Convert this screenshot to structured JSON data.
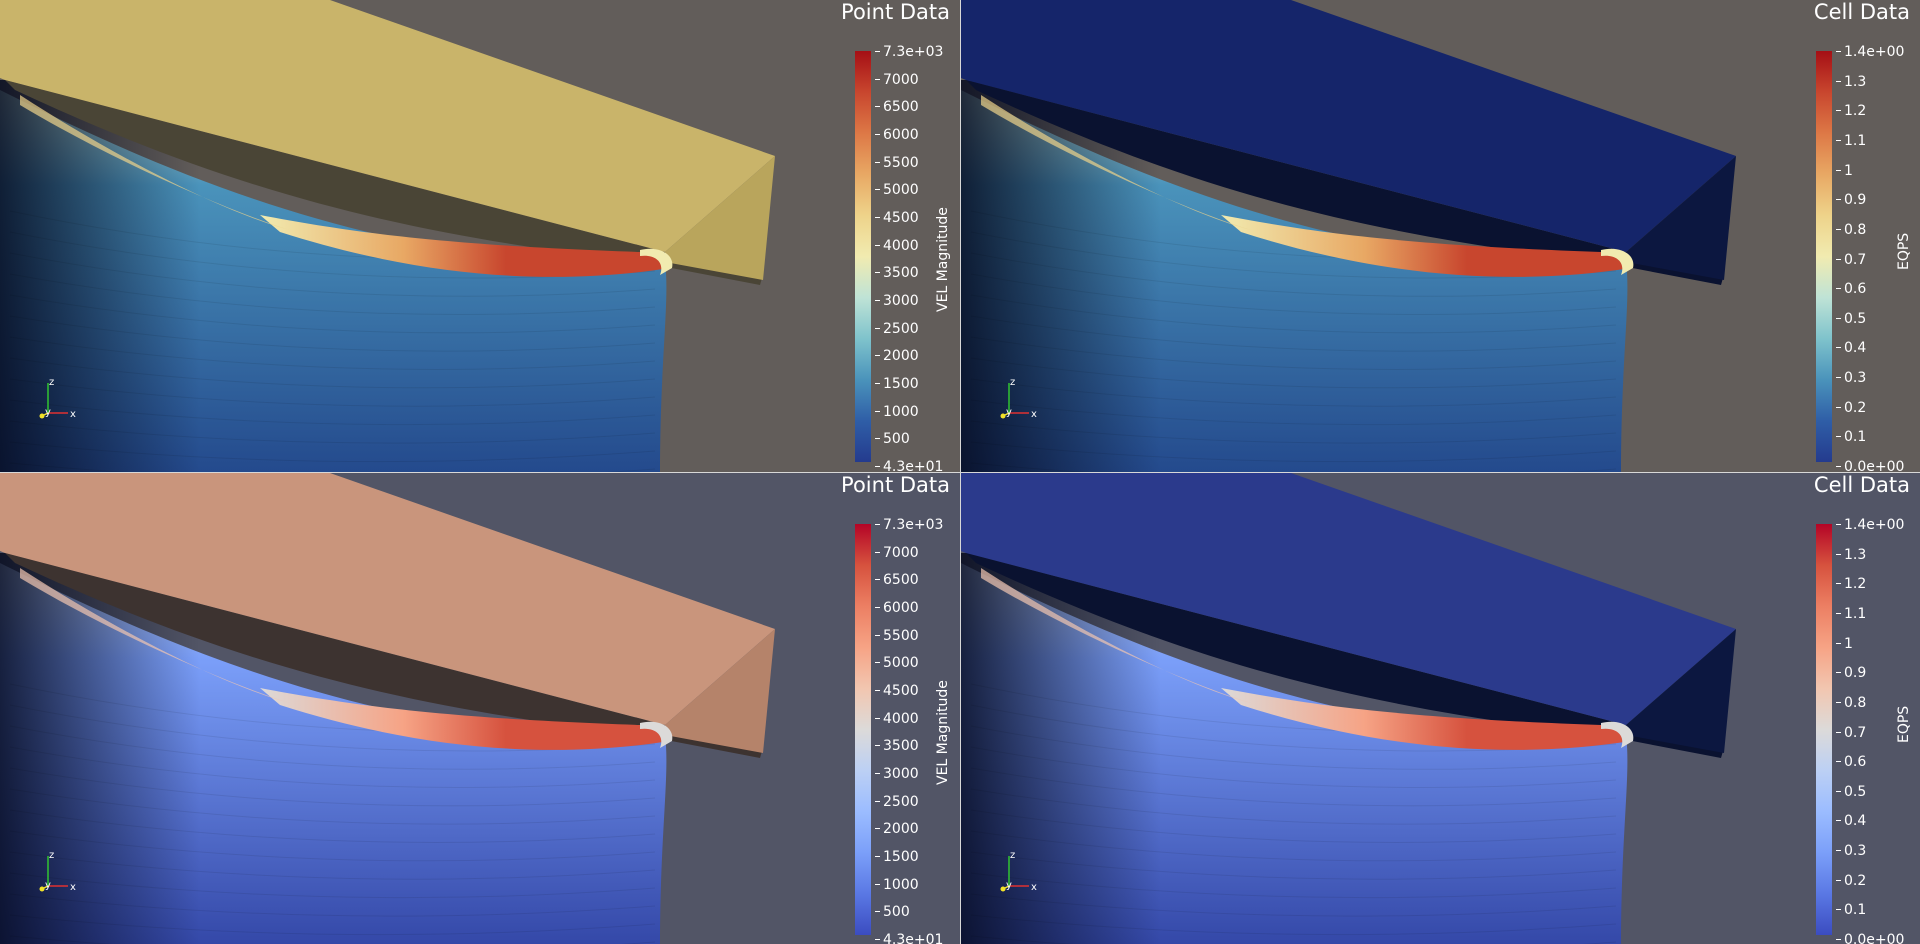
{
  "views": [
    {
      "title": "Point Data",
      "colorbar_title": "VEL Magnitude",
      "ticks": [
        "7.3e+03",
        "7000",
        "6500",
        "6000",
        "5500",
        "5000",
        "4500",
        "4000",
        "3500",
        "3000",
        "2500",
        "2000",
        "1500",
        "1000",
        "500",
        "4.3e+01"
      ],
      "background": "#625d5a",
      "colormap": [
        "#a50f15",
        "#c8462e",
        "#dd7846",
        "#e8a864",
        "#eed38a",
        "#f1ebb0",
        "#bfe3d6",
        "#7fc3cc",
        "#4a93bb",
        "#2f5ea7",
        "#243b8e"
      ]
    },
    {
      "title": "Cell Data",
      "colorbar_title": "EQPS",
      "ticks": [
        "1.4e+00",
        "1.3",
        "1.2",
        "1.1",
        "1",
        "0.9",
        "0.8",
        "0.7",
        "0.6",
        "0.5",
        "0.4",
        "0.3",
        "0.2",
        "0.1",
        "0.0e+00"
      ],
      "background": "#625d5a",
      "colormap": [
        "#a50f15",
        "#c8462e",
        "#dd7846",
        "#e8a864",
        "#eed38a",
        "#f1ebb0",
        "#bfe3d6",
        "#7fc3cc",
        "#4a93bb",
        "#2f5ea7",
        "#243b8e"
      ]
    },
    {
      "title": "Point Data",
      "colorbar_title": "VEL Magnitude",
      "ticks": [
        "7.3e+03",
        "7000",
        "6500",
        "6000",
        "5500",
        "5000",
        "4500",
        "4000",
        "3500",
        "3000",
        "2500",
        "2000",
        "1500",
        "1000",
        "500",
        "4.3e+01"
      ],
      "background": "#525566",
      "colormap": [
        "#b40426",
        "#d6523e",
        "#ec7f63",
        "#f6a385",
        "#f2c6b0",
        "#dcdad9",
        "#bcd0f4",
        "#9bbcff",
        "#7b9ff9",
        "#5a78e4",
        "#3b4cc0"
      ]
    },
    {
      "title": "Cell Data",
      "colorbar_title": "EQPS",
      "ticks": [
        "1.4e+00",
        "1.3",
        "1.2",
        "1.1",
        "1",
        "0.9",
        "0.8",
        "0.7",
        "0.6",
        "0.5",
        "0.4",
        "0.3",
        "0.2",
        "0.1",
        "0.0e+00"
      ],
      "background": "#525566",
      "colormap": [
        "#b40426",
        "#d6523e",
        "#ec7f63",
        "#f6a385",
        "#f2c6b0",
        "#dcdad9",
        "#bcd0f4",
        "#9bbcff",
        "#7b9ff9",
        "#5a78e4",
        "#3b4cc0"
      ]
    }
  ],
  "axes_labels": {
    "z": "z",
    "x": "x",
    "y": "y"
  },
  "colors": {
    "slab_yellow": "#c9b46a",
    "slab_peach": "#c9957c",
    "slab_blue_dark": "#15256a",
    "slab_blue": "#2b3a8c",
    "body_blue": "#244a8d",
    "body_blue_cool": "#3448a8",
    "axis_x": "#e03131",
    "axis_y": "#f2e22a",
    "axis_z": "#31c431"
  }
}
